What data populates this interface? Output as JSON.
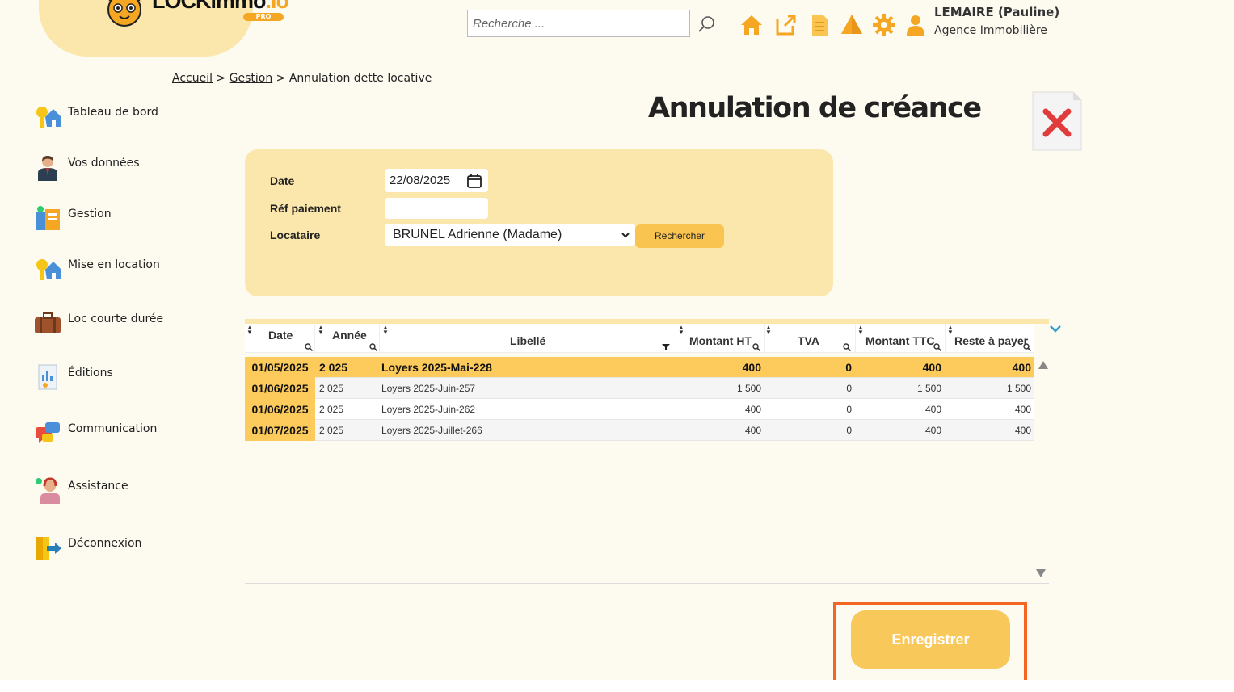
{
  "brand": {
    "logo_text_main": "LOCKimmo",
    "logo_text_suffix": ".io",
    "logo_badge": "PRO"
  },
  "header": {
    "search_placeholder": "Recherche ...",
    "user_name": "LEMAIRE (Pauline)",
    "user_agency": "Agence Immobilière",
    "icons": [
      "home-icon",
      "external-link-icon",
      "document-icon",
      "warning-icon",
      "settings-gear-icon",
      "user-icon"
    ]
  },
  "breadcrumb": {
    "level1": "Accueil",
    "sep1": ">",
    "level2": "Gestion",
    "sep2": ">",
    "current": "Annulation dette locative"
  },
  "sidebar": {
    "items": [
      {
        "label": "Tableau de bord",
        "icon": "dashboard-house-key-icon"
      },
      {
        "label": "Vos données",
        "icon": "person-icon"
      },
      {
        "label": "Gestion",
        "icon": "management-icon"
      },
      {
        "label": "Mise en location",
        "icon": "rental-house-key-icon"
      },
      {
        "label": "Loc courte durée",
        "icon": "suitcase-icon"
      },
      {
        "label": "Éditions",
        "icon": "report-icon"
      },
      {
        "label": "Communication",
        "icon": "chat-bubbles-icon"
      },
      {
        "label": "Assistance",
        "icon": "support-agent-icon"
      },
      {
        "label": "Déconnexion",
        "icon": "logout-icon"
      }
    ]
  },
  "page": {
    "title": "Annulation de créance"
  },
  "form": {
    "date_label": "Date",
    "date_value": "22/08/2025",
    "ref_label": "Réf paiement",
    "ref_value": "",
    "tenant_label": "Locataire",
    "tenant_value": "BRUNEL Adrienne (Madame)",
    "search_button": "Rechercher"
  },
  "table": {
    "columns": [
      "Date",
      "Année",
      "Libellé",
      "Montant HT",
      "TVA",
      "Montant TTC",
      "Reste à payer"
    ],
    "rows": [
      {
        "date": "01/05/2025",
        "year": "2 025",
        "label": "Loyers 2025-Mai-228",
        "ht": "400",
        "tva": "0",
        "ttc": "400",
        "rest": "400",
        "selected": true
      },
      {
        "date": "01/06/2025",
        "year": "2 025",
        "label": "Loyers 2025-Juin-257",
        "ht": "1 500",
        "tva": "0",
        "ttc": "1 500",
        "rest": "1 500",
        "selected": false
      },
      {
        "date": "01/06/2025",
        "year": "2 025",
        "label": "Loyers 2025-Juin-262",
        "ht": "400",
        "tva": "0",
        "ttc": "400",
        "rest": "400",
        "selected": false
      },
      {
        "date": "01/07/2025",
        "year": "2 025",
        "label": "Loyers 2025-Juillet-266",
        "ht": "400",
        "tva": "0",
        "ttc": "400",
        "rest": "400",
        "selected": false
      }
    ]
  },
  "actions": {
    "save_label": "Enregistrer"
  },
  "colors": {
    "accent": "#f9c44f",
    "panel": "#fbe7ab",
    "highlight_frame": "#f26522",
    "close_red": "#e03c3c"
  }
}
